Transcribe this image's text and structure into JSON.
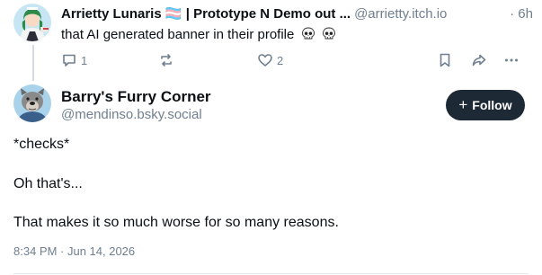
{
  "parent_post": {
    "author": "Arrietty Lunaris 🏳️‍⚧️ | Prototype N Demo out ...",
    "handle": "@arrietty.itch.io",
    "time": "· 6h",
    "text": "that AI generated banner in their profile",
    "reply_count": "1",
    "like_count": "2"
  },
  "main_post": {
    "author": "Barry's Furry Corner",
    "handle": "@mendinso.bsky.social",
    "follow_label": "Follow",
    "lines": [
      "*checks*",
      "Oh that's...",
      "That makes it so much worse for so many reasons."
    ],
    "timestamp": "8:34 PM · Jun 14, 2026"
  },
  "colors": {
    "follow_bg": "#1e2936",
    "muted_text": "#6f7f8f",
    "thread_line": "#d4dbe2"
  },
  "icons": [
    "reply-icon",
    "repost-icon",
    "like-icon",
    "bookmark-icon",
    "share-icon",
    "more-icon",
    "skull-emoji"
  ]
}
